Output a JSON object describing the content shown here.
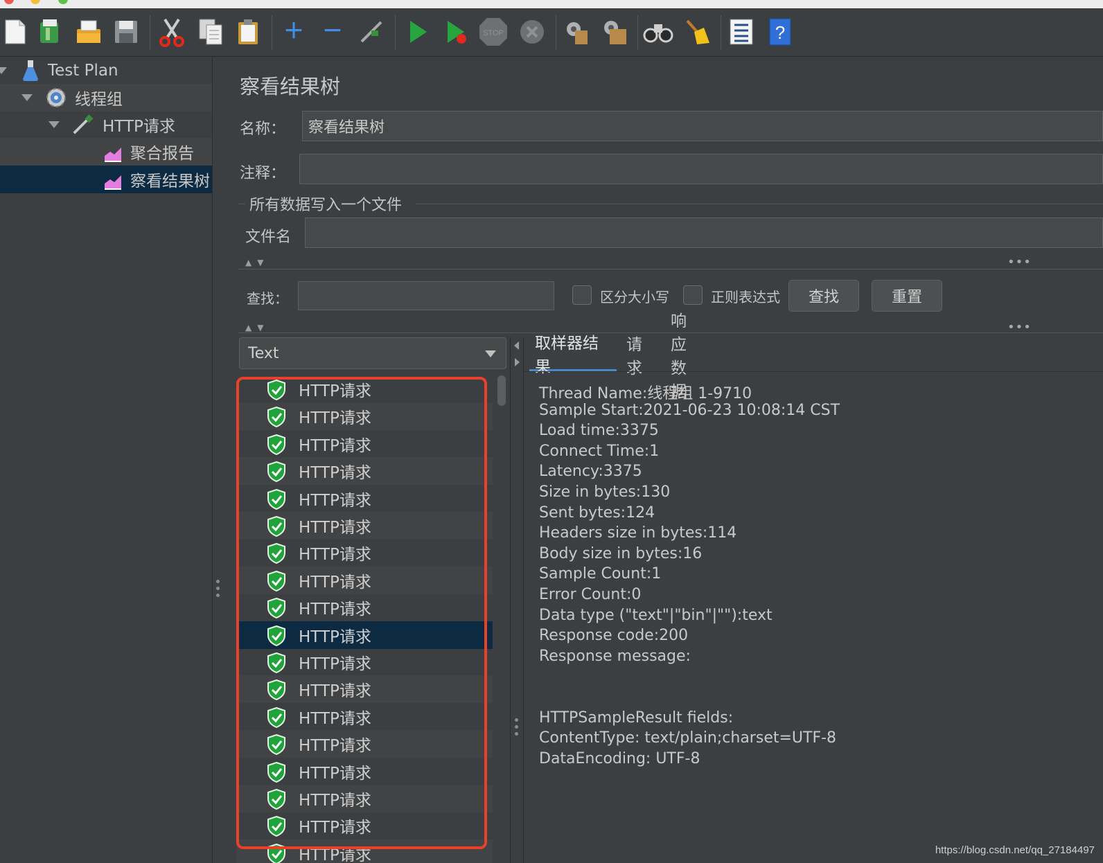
{
  "colors": {
    "background": "#3c3f41",
    "selection": "#0d2a43",
    "tab_accent": "#4a88c7",
    "annotation": "#e8402a",
    "success": "#1fa33a"
  },
  "toolbar": {
    "icons": [
      "new-icon",
      "templates-icon",
      "open-icon",
      "save-icon",
      "cut-icon",
      "copy-icon",
      "paste-icon",
      "expand-icon",
      "collapse-icon",
      "toggle-icon",
      "start-icon",
      "start-no-pause-icon",
      "stop-icon",
      "shutdown-icon",
      "clear-icon",
      "clear-all-icon",
      "search-icon",
      "reset-search-icon",
      "function-helper-icon",
      "help-icon"
    ]
  },
  "tree": {
    "items": [
      {
        "label": "Test Plan",
        "icon": "flask-icon"
      },
      {
        "label": "线程组",
        "icon": "gear-icon"
      },
      {
        "label": "HTTP请求",
        "icon": "pipette-icon"
      },
      {
        "label": "聚合报告",
        "icon": "graph-icon"
      },
      {
        "label": "察看结果树",
        "icon": "graph-icon"
      }
    ]
  },
  "form": {
    "title": "察看结果树",
    "name_label": "名称：",
    "name_value": "察看结果树",
    "comment_label": "注释：",
    "comment_value": "",
    "file_group_label": "所有数据写入一个文件",
    "filename_label": "文件名",
    "filename_value": ""
  },
  "search": {
    "label": "查找：",
    "value": "",
    "case_label": "区分大小写",
    "regex_label": "正则表达式",
    "find_button": "查找",
    "reset_button": "重置"
  },
  "renderer": {
    "selected": "Text"
  },
  "results": {
    "item_label": "HTTP请求",
    "count_visible": 17,
    "selected_index": 9,
    "partial_label": "HTTP请求"
  },
  "tabs": [
    "取样器结果",
    "请求",
    "响应数据"
  ],
  "sample_result": {
    "lines": [
      "Thread Name:线程组 1-9710",
      "Sample Start:2021-06-23 10:08:14 CST",
      "Load time:3375",
      "Connect Time:1",
      "Latency:3375",
      "Size in bytes:130",
      "Sent bytes:124",
      "Headers size in bytes:114",
      "Body size in bytes:16",
      "Sample Count:1",
      "Error Count:0",
      "Data type (\"text\"|\"bin\"|\"\"):text",
      "Response code:200",
      "Response message:",
      "",
      "",
      "HTTPSampleResult fields:",
      "ContentType: text/plain;charset=UTF-8",
      "DataEncoding: UTF-8"
    ]
  },
  "watermark": "https://blog.csdn.net/qq_27184497"
}
